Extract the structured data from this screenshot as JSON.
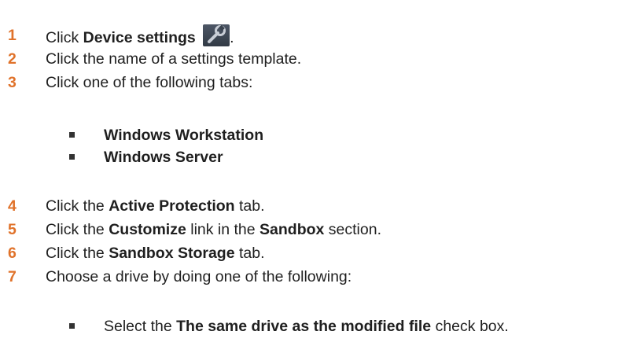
{
  "steps": [
    {
      "num": "1",
      "parts": {
        "a": "Click ",
        "b": "Device settings",
        "c": "."
      },
      "icon": "wrench-icon"
    },
    {
      "num": "2",
      "parts": {
        "a": "Click the name of a settings template."
      }
    },
    {
      "num": "3",
      "parts": {
        "a": "Click one of the following tabs:"
      },
      "bullets": [
        "Windows Workstation",
        "Windows Server"
      ]
    },
    {
      "num": "4",
      "parts": {
        "a": "Click the ",
        "b": "Active Protection",
        "c": " tab."
      }
    },
    {
      "num": "5",
      "parts": {
        "a": "Click the ",
        "b": "Customize",
        "c": " link in the ",
        "d": "Sandbox",
        "e": " section."
      }
    },
    {
      "num": "6",
      "parts": {
        "a": "Click the ",
        "b": "Sandbox Storage",
        "c": " tab."
      }
    },
    {
      "num": "7",
      "parts": {
        "a": "Choose a drive by doing one of the following:"
      },
      "bullets": [
        {
          "a": "Select the ",
          "b": "The same drive as the modified file",
          "c": " check box."
        }
      ]
    }
  ],
  "colors": {
    "step_number": "#e0722a",
    "text": "#1f1f1f",
    "bullet": "#333333",
    "icon_bg": "#3b4450",
    "icon_fg": "#c9ced6"
  }
}
